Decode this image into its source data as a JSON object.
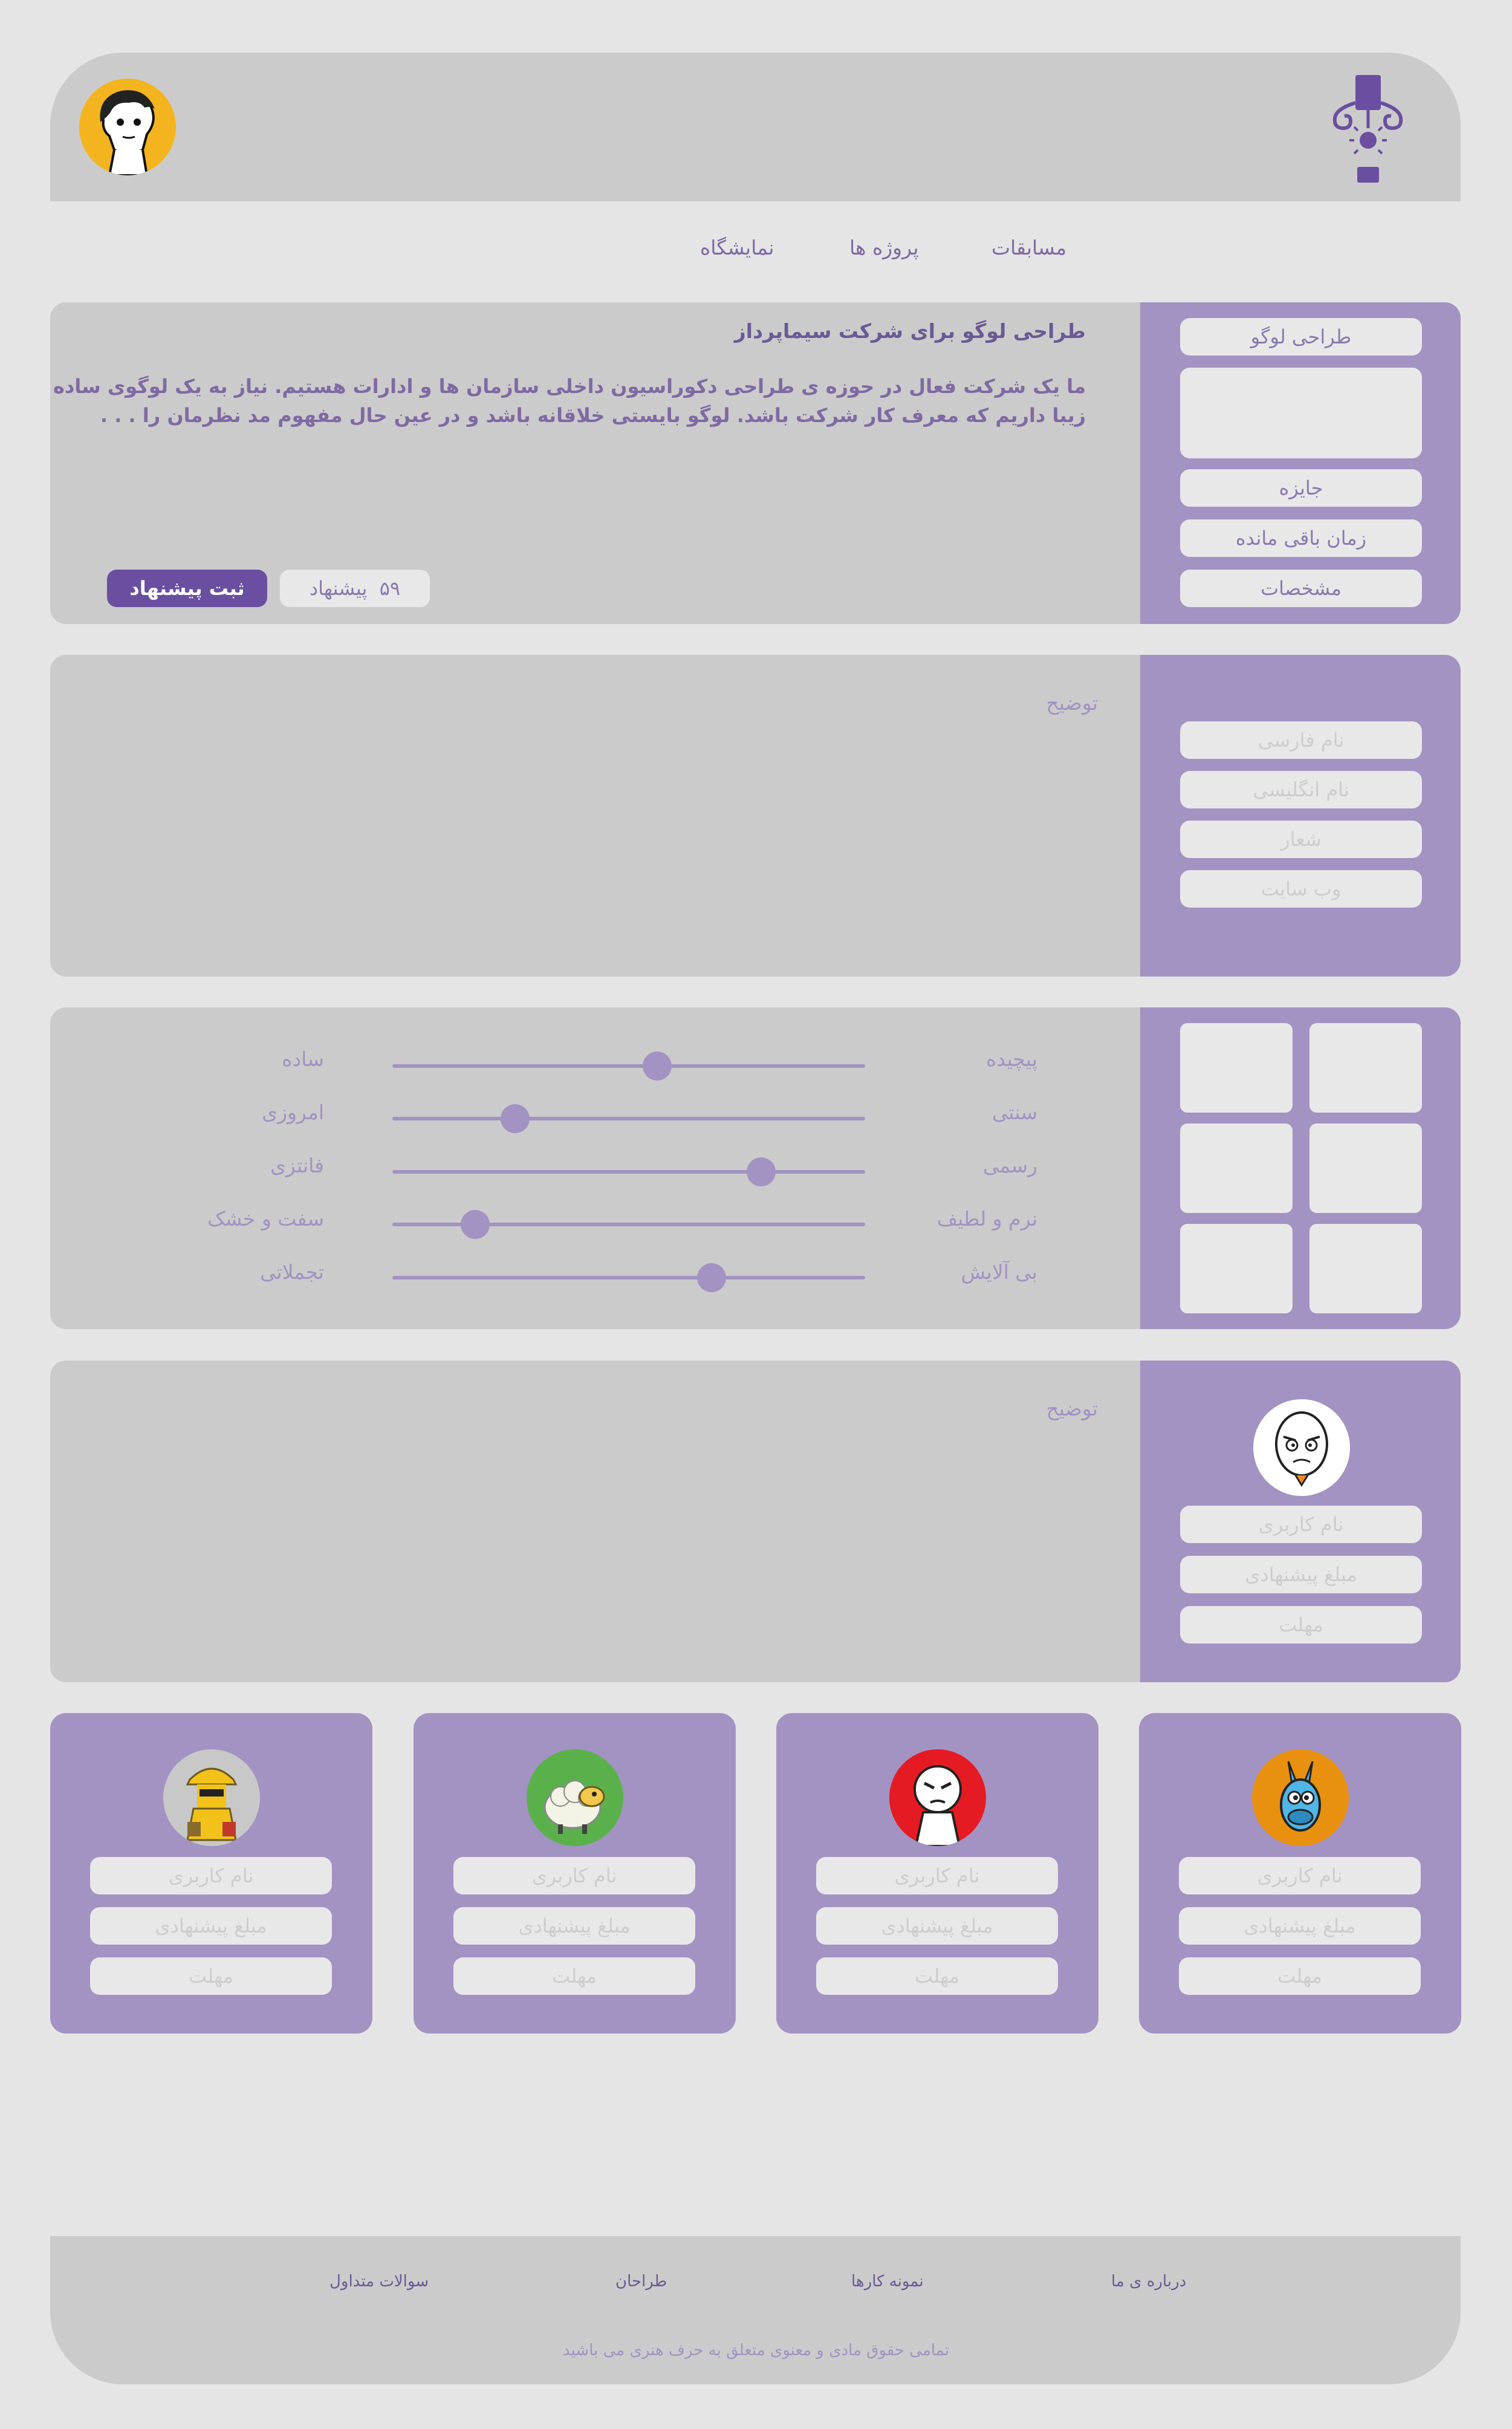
{
  "nav": {
    "competitions": "مسابقات",
    "projects": "پروژه ها",
    "gallery": "نمایشگاه"
  },
  "project": {
    "category": "طراحی لوگو",
    "title": "طراحی لوگو برای شرکت سیماپرداز",
    "description_line1": "ما یک شرکت فعال در حوزه ی طراحی دکوراسیون داخلی سازمان ها و ادارات هستیم. نیاز به یک لوگوی ساده اما",
    "description_line2": "زیبا داریم که معرف کار شرکت باشد. لوگو بایستی خلاقانه باشد و در عین حال مفهوم مد نظرمان را . . .",
    "prize_label": "جایزه",
    "time_left_label": "زمان باقی مانده",
    "specs_label": "مشخصات",
    "proposals_count": "۵۹",
    "proposals_label": "پیشنهاد",
    "submit_label": "ثبت پیشنهاد"
  },
  "brand_info": {
    "persian_name": "نام فارسی",
    "english_name": "نام انگلیسی",
    "slogan": "شعار",
    "website": "وب سایت",
    "description_label": "توضیح"
  },
  "style_sliders": [
    {
      "right": "پیچیده",
      "left": "ساده",
      "value": 0.56
    },
    {
      "right": "سنتی",
      "left": "امروزی",
      "value": 0.26
    },
    {
      "right": "رسمی",
      "left": "فانتزی",
      "value": 0.78
    },
    {
      "right": "نرم و لطیف",
      "left": "سفت و خشک",
      "value": 0.175
    },
    {
      "right": "بی آلایش",
      "left": "تجملاتی",
      "value": 0.675
    }
  ],
  "featured_bid": {
    "username": "نام کاربری",
    "amount": "مبلغ پیشنهادی",
    "deadline": "مهلت",
    "description_label": "توضیح"
  },
  "bids": [
    {
      "username": "نام کاربری",
      "amount": "مبلغ پیشنهادی",
      "deadline": "مهلت",
      "avatar": "donkey-avatar-icon",
      "bg": "#e8900f"
    },
    {
      "username": "نام کاربری",
      "amount": "مبلغ پیشنهادی",
      "deadline": "مهلت",
      "avatar": "angry-face-avatar-icon",
      "bg": "#e51b24"
    },
    {
      "username": "نام کاربری",
      "amount": "مبلغ پیشنهادی",
      "deadline": "مهلت",
      "avatar": "sheep-avatar-icon",
      "bg": "#5ab14c"
    },
    {
      "username": "نام کاربری",
      "amount": "مبلغ پیشنهادی",
      "deadline": "مهلت",
      "avatar": "builder-avatar-icon",
      "bg": "#c8c8c8"
    }
  ],
  "footer": {
    "about": "درباره ی ما",
    "samples": "نمونه کارها",
    "designers": "طراحان",
    "faq": "سوالات متداول",
    "copyright": "تمامی حقوق مادی و معنوی متعلق به حرف هنری می باشید"
  },
  "colors": {
    "accent": "#a293c2",
    "brand_dark": "#6a4fa0",
    "card_bg": "#cbcbcb",
    "page_bg": "#e5e5e5"
  }
}
